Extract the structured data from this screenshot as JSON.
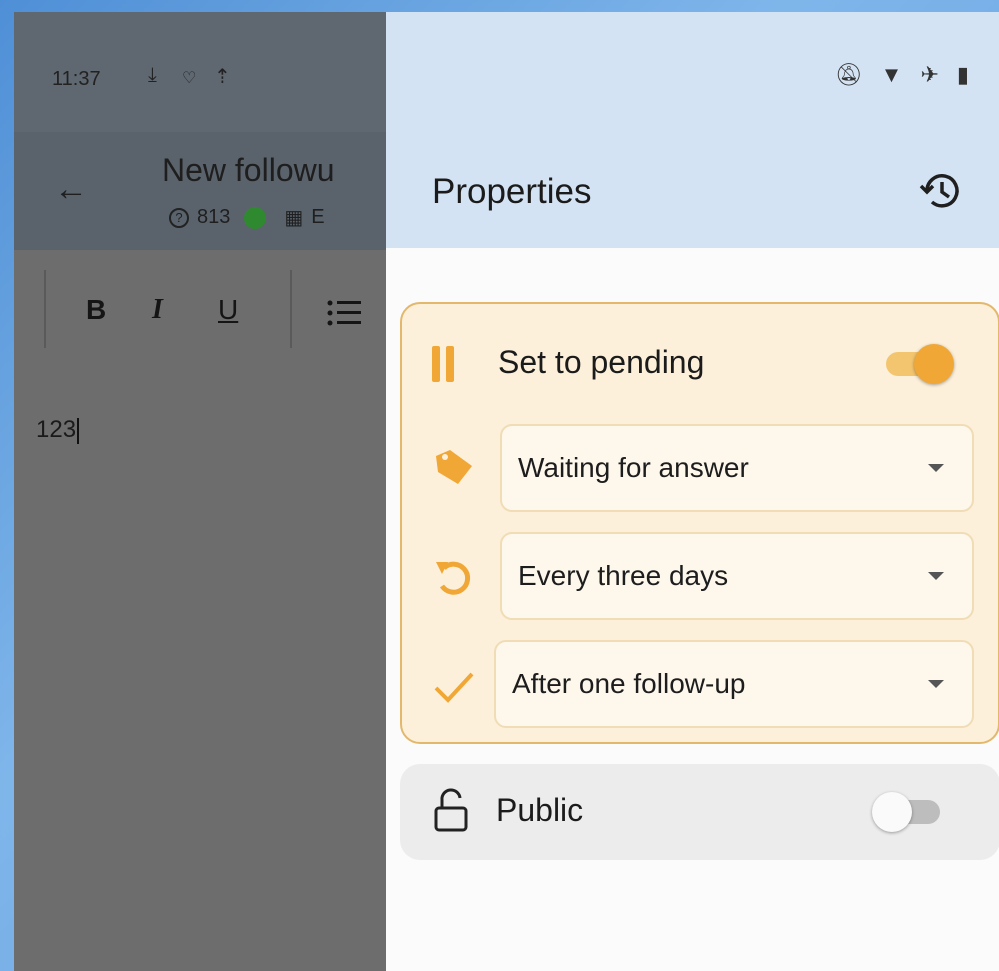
{
  "left_screen": {
    "time": "11:37",
    "status_icons": [
      "download-icon",
      "signal-icon",
      "upload-icon"
    ],
    "doc_title": "New followu",
    "ticket_number": "813",
    "org_abbrev": "E",
    "toolbar": {
      "bold": "B",
      "italic": "I",
      "underline": "U"
    },
    "editor_text": "123"
  },
  "panel": {
    "status_icons": [
      "bell-off-icon",
      "wifi-icon",
      "airplane-icon",
      "battery-icon"
    ],
    "title": "Properties",
    "pending": {
      "label": "Set to pending",
      "enabled": true,
      "state_option": "Waiting for answer",
      "interval_option": "Every three days",
      "stop_option": "After one follow-up"
    },
    "public": {
      "label": "Public",
      "enabled": false
    }
  },
  "colors": {
    "accent": "#f0a736",
    "card_bg": "#fcf0da",
    "card_border": "#e3b86d",
    "panel_header": "#d4e3f3"
  }
}
